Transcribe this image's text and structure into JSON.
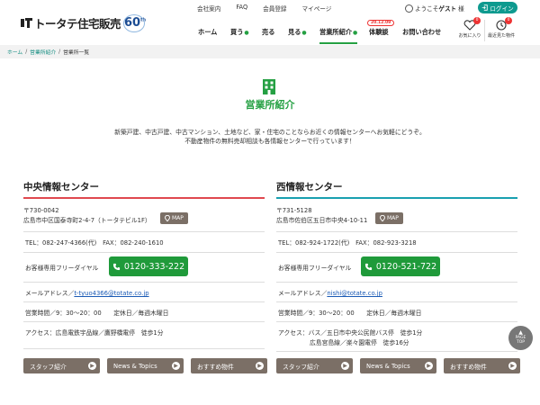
{
  "header": {
    "logo_text": "トータテ住宅販売",
    "logo_badge": "60",
    "logo_badge_suffix": "th",
    "top_links": [
      "会社案内",
      "FAQ",
      "会員登録",
      "マイページ"
    ],
    "welcome_prefix": "ようこそ",
    "welcome_user": "ゲスト",
    "welcome_suffix": "様",
    "login_label": "ログイン",
    "main_nav": [
      {
        "label": "ホーム",
        "has_dropdown": false
      },
      {
        "label": "買う",
        "has_dropdown": true
      },
      {
        "label": "売る",
        "has_dropdown": false
      },
      {
        "label": "見る",
        "has_dropdown": true
      },
      {
        "label": "営業所紹介",
        "has_dropdown": true,
        "active": true
      },
      {
        "label": "体験談",
        "has_dropdown": false,
        "badge": "20.12.09"
      },
      {
        "label": "お問い合わせ",
        "has_dropdown": false
      }
    ],
    "favorites": {
      "label": "お気に入り",
      "count": "0"
    },
    "recent": {
      "label": "最近見た物件",
      "count": "0"
    }
  },
  "breadcrumb": [
    "ホーム",
    "営業所紹介",
    "営業所一覧"
  ],
  "page": {
    "title": "営業所紹介",
    "lead_line1": "新築戸建、中古戸建、中古マンション、土地など、家・住宅のことならお近くの情報センターへお気軽にどうぞ。",
    "lead_line2": "不動産物件の無料売却相談も各情報センターで行っています！"
  },
  "offices": [
    {
      "name": "中央情報センター",
      "accent": "#e0484f",
      "postal": "〒730-0042",
      "address": "広島市中区国泰寺町2-4-7（トータテビル1F）",
      "map_label": "MAP",
      "tel": "TEL：082-247-4366(代)　FAX：082-240-1610",
      "free_label": "お客様専用フリーダイヤル",
      "free_number": "0120-333-222",
      "mail_label": "メールアドレス／",
      "mail": "t-tyuo4366@totate.co.jp",
      "hours": "営業時間／9：30～20：00　　定休日／毎週木曜日",
      "access_lines": [
        "アクセス：広島電鉄宇品線／鷹野橋電停　徒歩1分"
      ],
      "buttons": [
        "スタッフ紹介",
        "News & Topics",
        "おすすめ物件"
      ]
    },
    {
      "name": "西情報センター",
      "accent": "#19a0b0",
      "postal": "〒731-5128",
      "address": "広島市佐伯区五日市中央4-10-11",
      "map_label": "MAP",
      "tel": "TEL：082-924-1722(代)　FAX：082-923-3218",
      "free_label": "お客様専用フリーダイヤル",
      "free_number": "0120-521-722",
      "mail_label": "メールアドレス／",
      "mail": "nishi@totate.co.jp",
      "hours": "営業時間／9：30～20：00　　定休日／毎週木曜日",
      "access_lines": [
        "アクセス：バス／五日市中央公民館バス停　徒歩1分",
        "広島宮島線／楽々園電停　徒歩16分"
      ],
      "buttons": [
        "スタッフ紹介",
        "News & Topics",
        "おすすめ物件"
      ]
    }
  ],
  "pagetop": {
    "line1": "PAGE",
    "line2": "TOP"
  },
  "colors": {
    "green": "#25a043",
    "teal": "#0e9a8f",
    "brown_button": "#7b6f66"
  }
}
